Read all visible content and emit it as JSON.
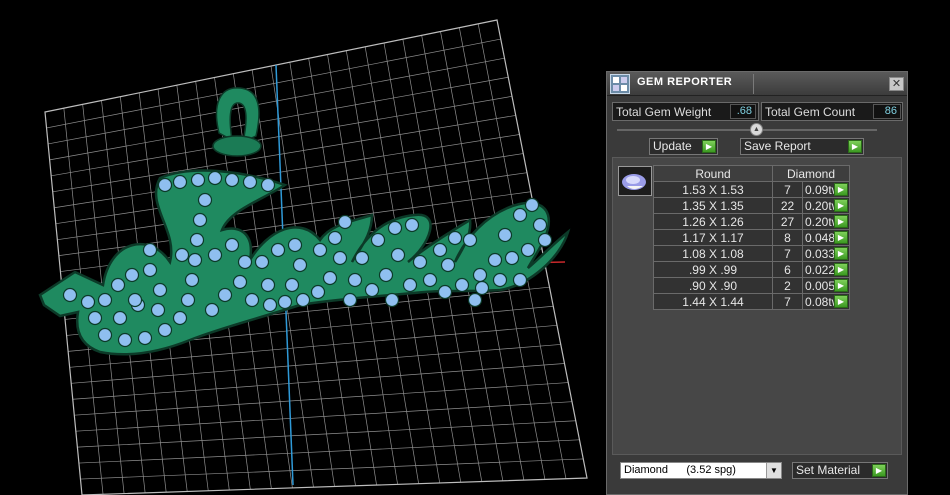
{
  "window": {
    "title": "GEM REPORTER",
    "close_glyph": "✕"
  },
  "stats": {
    "weight_label": "Total Gem Weight",
    "weight_value": ".68",
    "count_label": "Total Gem Count",
    "count_value": "86"
  },
  "buttons": {
    "update": "Update",
    "save_report": "Save Report",
    "set_material": "Set Material",
    "go_glyph": "▶"
  },
  "table": {
    "headers": [
      "Round",
      "Diamond"
    ],
    "rows": [
      {
        "size": "1.53 X 1.53",
        "count": "7",
        "weight": "0.09tw"
      },
      {
        "size": "1.35 X 1.35",
        "count": "22",
        "weight": "0.20tw"
      },
      {
        "size": "1.26 X 1.26",
        "count": "27",
        "weight": "0.20tw"
      },
      {
        "size": "1.17 X 1.17",
        "count": "8",
        "weight": "0.048tw"
      },
      {
        "size": "1.08 X 1.08",
        "count": "7",
        "weight": "0.033tw"
      },
      {
        "size": ".99 X .99",
        "count": "6",
        "weight": "0.022tw"
      },
      {
        "size": ".90 X .90",
        "count": "2",
        "weight": "0.005tw"
      },
      {
        "size": "1.44 X 1.44",
        "count": "7",
        "weight": "0.08tw"
      }
    ]
  },
  "material": {
    "selected": "Diamond      (3.52 spg)"
  },
  "viewport": {
    "text": "Faiza",
    "metal_color": "#1f8a60",
    "stone_color": "#8fbff0",
    "grid_color": "#9a9a9a"
  },
  "icons": {
    "app": "gem-reporter-app-icon",
    "gem": "round-diamond-icon",
    "dropdown": "chevron-down-icon"
  }
}
